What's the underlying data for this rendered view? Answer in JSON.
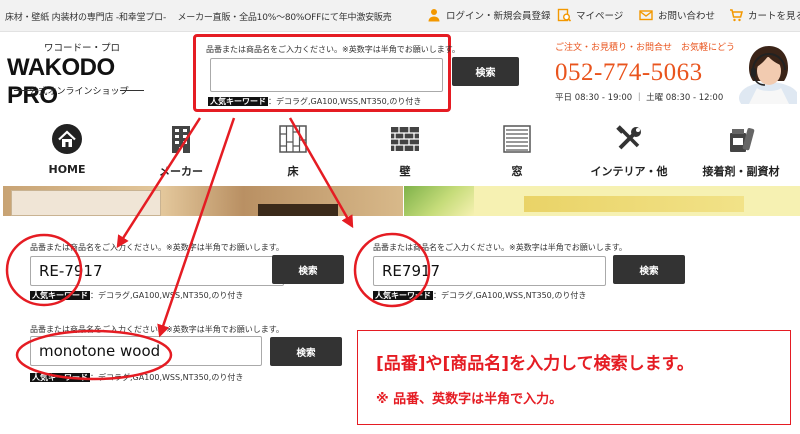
{
  "topbar": {
    "tagline": "床材・壁紙 内装材の専門店 -和幸堂プロ-　 メーカー直販・全品10%～80%OFFにて年中激安販売",
    "login": "ログイン・新規会員登録",
    "mypage": "マイページ",
    "contact": "お問い合わせ",
    "cart": "カートを見る"
  },
  "logo": {
    "kana": "ワコードー・プロ",
    "name": "WAKODO PRO",
    "sub": "公式オンラインショップ"
  },
  "header_search": {
    "label": "品番または商品名をご入力ください。※英数字は半角でお願いします。",
    "value": "",
    "keyword_tag": "人気キーワード",
    "keywords": "：デコラグ,GA100,WSS,NT350,のり付き",
    "button": "検索"
  },
  "contact": {
    "lead": "ご注文・お見積り・お問合せ　お気軽にどうぞ。",
    "tel": "052-774-5063",
    "hours": "平日 08:30 - 19:00 ｜ 土曜 08:30 - 12:00"
  },
  "nav": {
    "items": [
      {
        "label": "HOME",
        "icon": "home-icon"
      },
      {
        "label": "メーカー",
        "icon": "building-icon"
      },
      {
        "label": "床",
        "icon": "floor-icon"
      },
      {
        "label": "壁",
        "icon": "wall-icon"
      },
      {
        "label": "窓",
        "icon": "window-blind-icon"
      },
      {
        "label": "インテリア・他",
        "icon": "tools-icon"
      },
      {
        "label": "接着剤・副資材",
        "icon": "adhesive-icon"
      }
    ]
  },
  "examples": [
    {
      "label": "品番または商品名をご入力ください。※英数字は半角でお願いします。",
      "value": "RE-7917",
      "button": "検索",
      "keyword_tag": "人気キーワード",
      "keywords": "：デコラグ,GA100,WSS,NT350,のり付き"
    },
    {
      "label": "品番または商品名をご入力ください。※英数字は半角でお願いします。",
      "value": "RE7917",
      "button": "検索",
      "keyword_tag": "人気キーワード",
      "keywords": "：デコラグ,GA100,WSS,NT350,のり付き"
    },
    {
      "label": "品番または商品名をご入力ください。※英数字は半角でお願いします。",
      "value": "monotone wood",
      "button": "検索",
      "keyword_tag": "人気キーワード",
      "keywords": "：デコラグ,GA100,WSS,NT350,のり付き"
    }
  ],
  "note": {
    "line1": "[品番]や[商品名]を入力して検索します。",
    "line2": "※ 品番、英数字は半角で入力。"
  },
  "colors": {
    "accent_red": "#e51c23",
    "tel_orange": "#e9541d",
    "button_dark": "#333333"
  }
}
